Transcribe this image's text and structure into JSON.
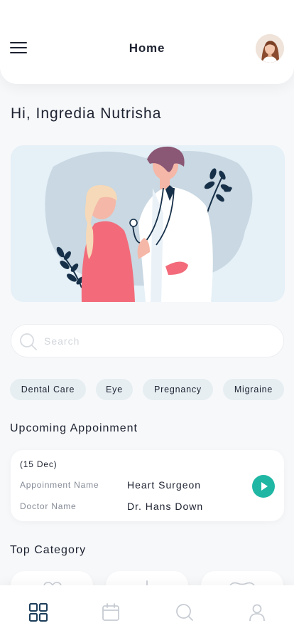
{
  "header": {
    "title": "Home",
    "menu_icon": "hamburger-menu-icon",
    "avatar_icon": "user-avatar"
  },
  "greeting": "Hi, Ingredia Nutrisha",
  "hero": {
    "illustration": "doctor-consulting-patient-illustration"
  },
  "search": {
    "placeholder": "Search",
    "value": "",
    "icon": "search-icon"
  },
  "chips": [
    "Dental Care",
    "Eye",
    "Pregnancy",
    "Migraine"
  ],
  "upcoming": {
    "title": "Upcoming Appoinment",
    "date": "(15 Dec)",
    "appointment_label": "Appoinment Name",
    "appointment_value": "Heart Surgeon",
    "doctor_label": "Doctor Name",
    "doctor_value": "Dr. Hans Down",
    "action_icon": "play-icon"
  },
  "top_category": {
    "title": "Top Category",
    "icons": [
      "heart-icon",
      "thermometer-icon",
      "tooth-icon"
    ]
  },
  "bottom_nav": {
    "items": [
      "home-grid-icon",
      "calendar-icon",
      "search-icon",
      "profile-icon"
    ],
    "active": "home-grid-icon"
  },
  "colors": {
    "accent": "#1fb7a4",
    "chip_bg": "#e6eef2",
    "hero_bg": "#e5f0f7",
    "active_nav": "#1c3d5a",
    "inactive_nav": "#c7ccd3"
  }
}
